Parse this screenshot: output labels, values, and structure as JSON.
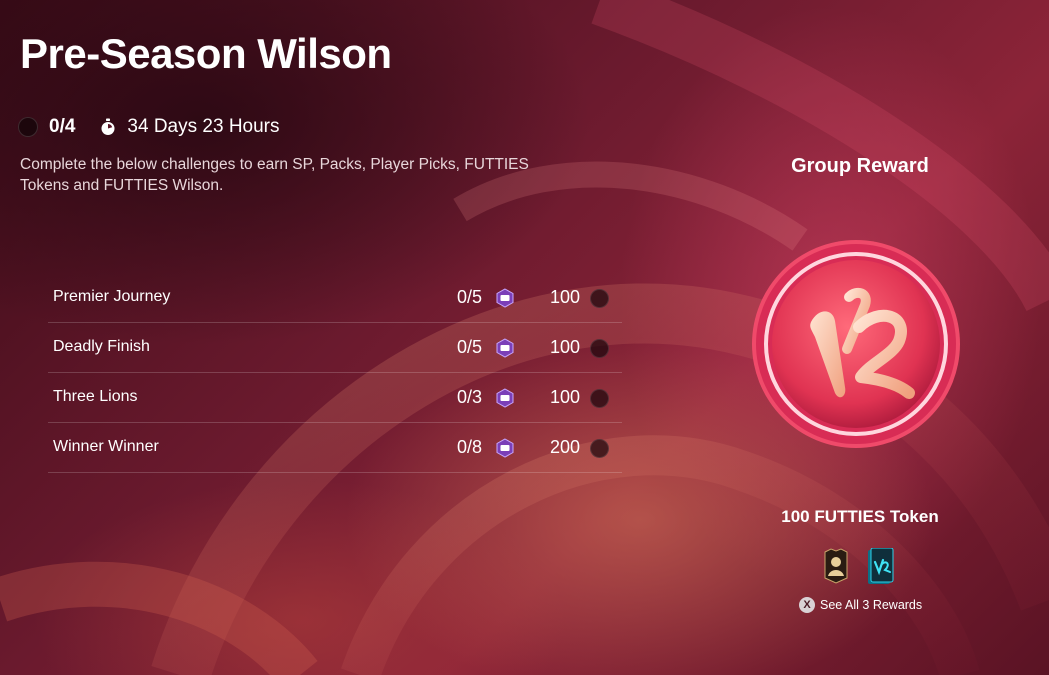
{
  "header": {
    "title": "Pre-Season Wilson",
    "progress": "0/4",
    "timer": "34 Days 23 Hours",
    "description": "Complete the below challenges to earn SP, Packs, Player Picks, FUTTIES Tokens and FUTTIES Wilson."
  },
  "challenges": [
    {
      "name": "Premier Journey",
      "progress": "0/5",
      "points": "100"
    },
    {
      "name": "Deadly Finish",
      "progress": "0/5",
      "points": "100"
    },
    {
      "name": "Three Lions",
      "progress": "0/3",
      "points": "100"
    },
    {
      "name": "Winner Winner",
      "progress": "0/8",
      "points": "200"
    }
  ],
  "reward": {
    "heading": "Group Reward",
    "token_label": "100 FUTTIES Token",
    "see_all_button": "X",
    "see_all": "See All 3 Rewards",
    "token_icon": "futties-token-icon",
    "reward_icons": [
      "player-card-icon",
      "futties-pack-icon"
    ]
  },
  "icons": {
    "progress": "circle-progress-icon",
    "timer": "stopwatch-icon",
    "points": "season-points-icon",
    "status": "completion-dot-icon"
  },
  "colors": {
    "accent": "#e23a5f",
    "token_rim": "#d82c55",
    "points_badge": "#7b3fb8"
  }
}
